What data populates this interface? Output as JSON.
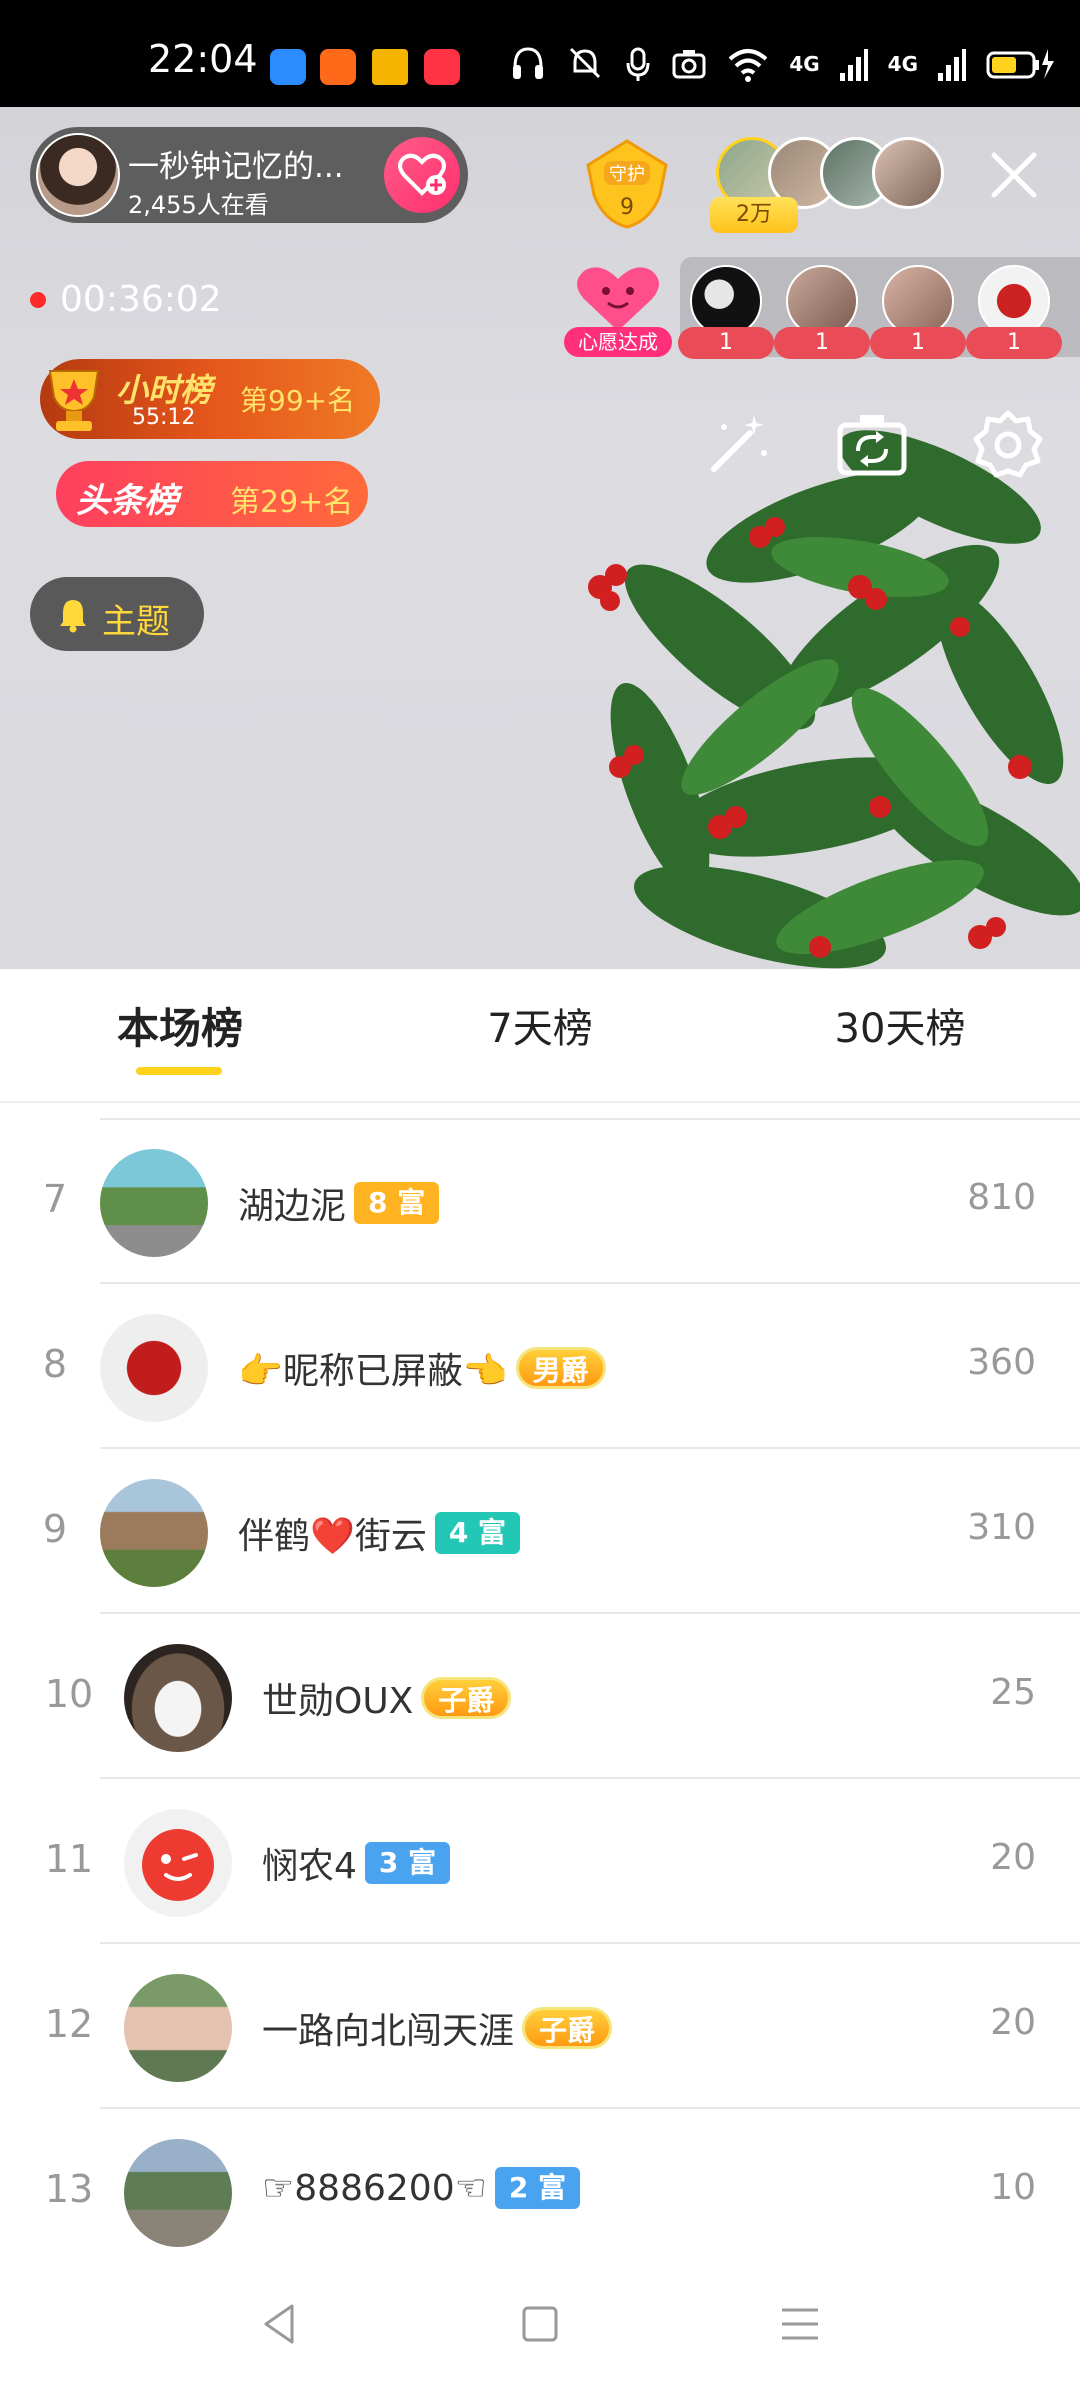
{
  "status_bar": {
    "time": "22:04",
    "network_1": "4G",
    "network_2": "4G",
    "icons": [
      "headset-icon",
      "mute-vibrate-icon",
      "mic-icon",
      "camera-icon",
      "wifi-icon",
      "signal-icon",
      "signal-icon",
      "battery-charging-icon"
    ]
  },
  "live": {
    "anchor_name": "一秒钟记忆的...",
    "viewers": "2,455人在看",
    "guard_label": "守护",
    "guard_count": "9",
    "audience_badge": "2万",
    "record_time": "00:36:02",
    "wish_label": "心愿达成",
    "gifter_counts": [
      "1",
      "1",
      "1",
      "1"
    ],
    "hourly_rank": {
      "name": "小时榜",
      "timer": "55:12",
      "rank": "第99+名"
    },
    "headline_rank": {
      "name": "头条榜",
      "rank": "第29+名"
    },
    "topic_label": "主题"
  },
  "tabs": [
    {
      "label": "本场榜",
      "active": true
    },
    {
      "label": "7天榜",
      "active": false
    },
    {
      "label": "30天榜",
      "active": false
    }
  ],
  "rankings": [
    {
      "rank": "7",
      "name": "湖边泥",
      "badge": "8 富",
      "badge_type": "rich-orange",
      "score": "810"
    },
    {
      "rank": "8",
      "name": "👉昵称已屏蔽👈",
      "badge": "男爵",
      "badge_type": "noble",
      "score": "360"
    },
    {
      "rank": "9",
      "name": "伴鹤❤️街云",
      "badge": "4 富",
      "badge_type": "rich-teal",
      "score": "310"
    },
    {
      "rank": "10",
      "name": "世勋OUX",
      "badge": "子爵",
      "badge_type": "noble",
      "score": "25"
    },
    {
      "rank": "11",
      "name": "悯农4",
      "badge": "3 富",
      "badge_type": "rich-blue",
      "score": "20"
    },
    {
      "rank": "12",
      "name": "一路向北闯天涯",
      "badge": "子爵",
      "badge_type": "noble",
      "score": "20"
    },
    {
      "rank": "13",
      "name": "☞8886200☜",
      "badge": "2 富",
      "badge_type": "rich-blue",
      "score": "10"
    }
  ],
  "colors": {
    "accent_yellow": "#ffd21e",
    "follow_pink": "#ff2f6d",
    "record_red": "#ff2b2b"
  }
}
